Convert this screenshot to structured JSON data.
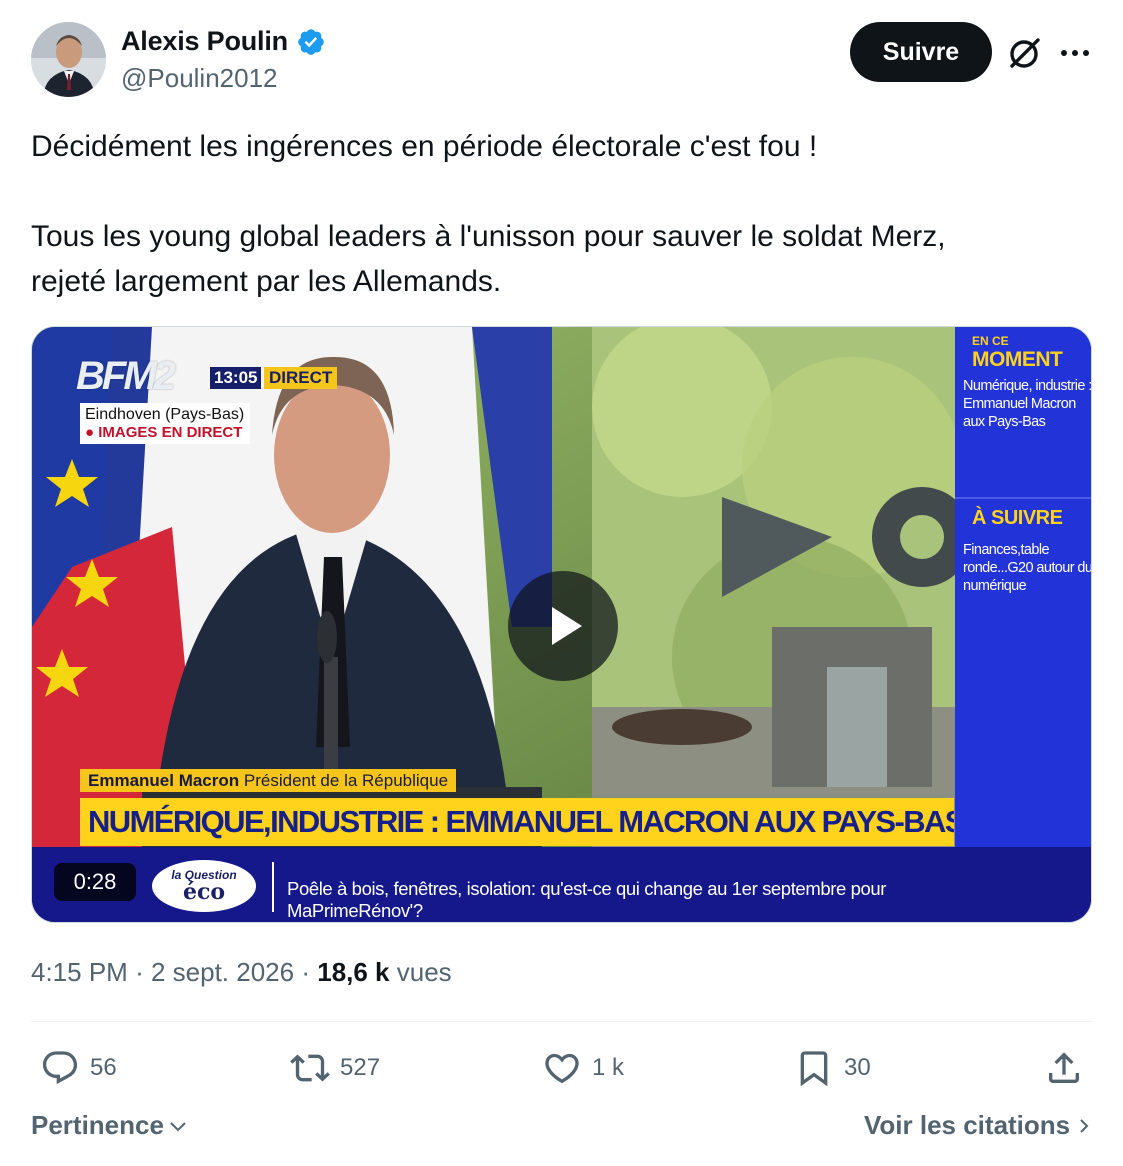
{
  "author": {
    "name": "Alexis Poulin",
    "handle": "@Poulin2012"
  },
  "actions_top": {
    "follow_label": "Suivre"
  },
  "tweet": {
    "line1": "Décidément les ingérences en période électorale c'est fou !",
    "line2": "Tous les young global leaders à l'unisson pour sauver le soldat Merz,",
    "line3": "rejeté largement par les Allemands."
  },
  "video": {
    "duration": "0:28",
    "channel_logo": "BFM2",
    "clock": "13:05",
    "live_tag": "DIRECT",
    "location": "Eindhoven (Pays-Bas)",
    "live_images": "● IMAGES EN DIRECT",
    "side_now_small": "EN CE",
    "side_now_title": "MOMENT",
    "side_now_text": "Numérique, industrie : Emmanuel Macron aux Pays-Bas",
    "side_next_title": "À SUIVRE",
    "side_next_text": "Finances,table ronde...G20 autour du numérique",
    "speaker_name": "Emmanuel Macron",
    "speaker_role": "Président de la République",
    "headline": "NUMÉRIQUE,INDUSTRIE : EMMANUEL MACRON AUX PAYS-BAS",
    "program_small": "la Question",
    "program_big": "éco",
    "ticker": "Poêle à bois, fenêtres, isolation: qu'est-ce qui change au 1er septembre pour MaPrimeRénov'?"
  },
  "meta": {
    "time": "4:15 PM",
    "separator": "·",
    "date": "2 sept. 2026",
    "views_count": "18,6 k",
    "views_label": "vues"
  },
  "stats": {
    "replies": "56",
    "reposts": "527",
    "likes": "1 k",
    "bookmarks": "30"
  },
  "footer": {
    "sort_label": "Pertinence",
    "quotes_label": "Voir les citations"
  },
  "colors": {
    "text": "#0f1419",
    "secondary": "#536471",
    "verified": "#1d9bf0",
    "bfm_yellow": "#ffd21c",
    "bfm_blue": "#2233d8"
  }
}
